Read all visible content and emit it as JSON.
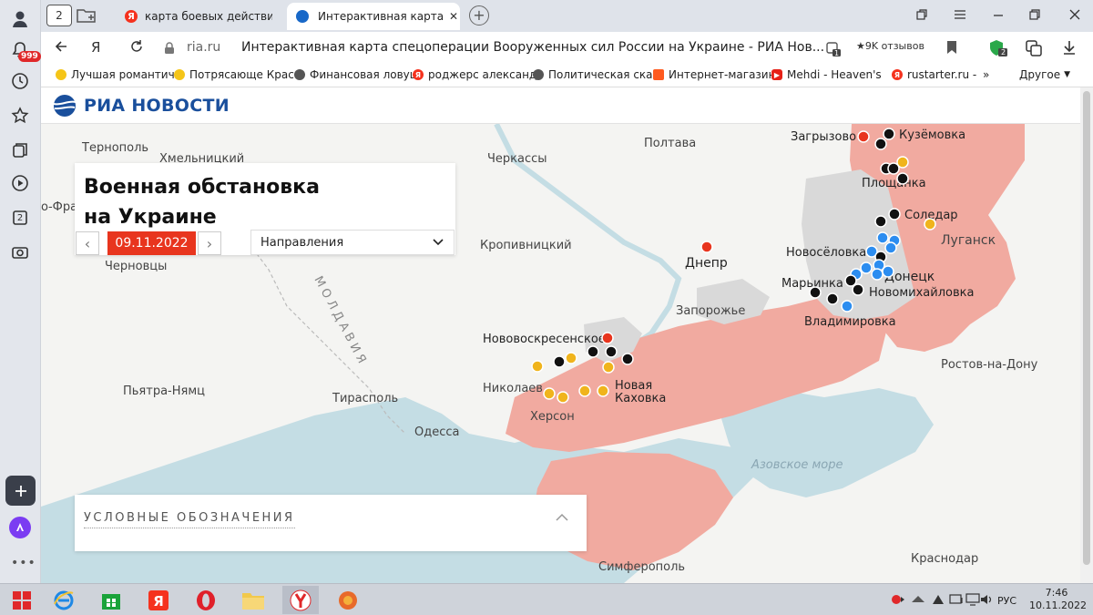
{
  "tabs": {
    "counter": "2",
    "tab1_title": "карта боевых действий на",
    "tab2_title": "Интерактивная карта сп",
    "tab2_close": "✕"
  },
  "addressbar": {
    "ya_button": "Я",
    "domain": "ria.ru",
    "page_title": "Интерактивная карта спецоперации Вооруженных сил России на Украине - РИА Нов...",
    "reviews": "★9K отзывов",
    "pin_badge": "1",
    "shield_badge": "2"
  },
  "sidebar": {
    "notifications_badge": "999",
    "tab_count": "2"
  },
  "bookmarks": {
    "items": [
      {
        "label": "Лучшая романтич",
        "icon_color": "#f5c518"
      },
      {
        "label": "Потрясающе Крас",
        "icon_color": "#f5c518"
      },
      {
        "label": "Финансовая ловуш",
        "icon_color": "#555555"
      },
      {
        "label": "роджерс александ",
        "icon_color": "#f5321e"
      },
      {
        "label": "Политическая ска",
        "icon_color": "#555555"
      },
      {
        "label": "Интернет-магазин",
        "icon_color": "#ff5a1f"
      },
      {
        "label": "Mehdi - Heaven's",
        "icon_color": "#e62117"
      },
      {
        "label": "rustarter.ru -",
        "icon_color": "#f5321e"
      }
    ],
    "more": "»",
    "other": "Другое"
  },
  "ria": {
    "brand": "РИА НОВОСТИ",
    "title_line1": "Военная обстановка",
    "title_line2": "на Украине",
    "date": "09.11.2022",
    "prev_arrow": "‹",
    "next_arrow": "›",
    "directions": "Направления",
    "legend_title": "УСЛОВНЫЕ ОБОЗНАЧЕНИЯ"
  },
  "map_labels": {
    "ternopol": "Тернополь",
    "khmelnitsky": "Хмельницкий",
    "ivano": "о-Фра",
    "chernovtsy": "Черновцы",
    "moldavia": "МОЛДАВИЯ",
    "piatra": "Пьятра-Нямц",
    "tiraspol": "Тирасполь",
    "odessa": "Одесса",
    "cherkassy": "Черкассы",
    "kropyvnytskyi": "Кропивницкий",
    "poltava": "Полтава",
    "dnepr": "Днепр",
    "zaporozhye": "Запорожье",
    "novovoskresenskoe": "Нововоскресенское",
    "nikolaev": "Николаев",
    "kherson": "Херсон",
    "nova_kakhovka": "Новая Каховка",
    "zagryzovo": "Загрызово",
    "kuzemovka": "Кузёмовка",
    "ploshchanka": "Площанка",
    "soledar": "Соледар",
    "lugansk": "Луганск",
    "novoselovka": "Новосёловка",
    "donetsk": "Донецк",
    "marinka": "Марьинка",
    "novomikhailovka": "Новомихайловка",
    "vladimirovka": "Владимировка",
    "rostov": "Ростов-на-Дону",
    "azov": "Азовское море",
    "krasnodar": "Краснодар",
    "simferopol": "Симферополь"
  },
  "map_colors": {
    "water": "#c4dde4",
    "land": "#f4f4f2",
    "controlled": "#f1aaa0",
    "contested": "#d9d9d9",
    "dot_black": "#111111",
    "dot_red": "#e8351e",
    "dot_blue": "#2c8df0",
    "dot_yellow": "#f0b41c"
  },
  "taskbar": {
    "lang": "РУС",
    "time": "7:46",
    "date": "10.11.2022"
  }
}
